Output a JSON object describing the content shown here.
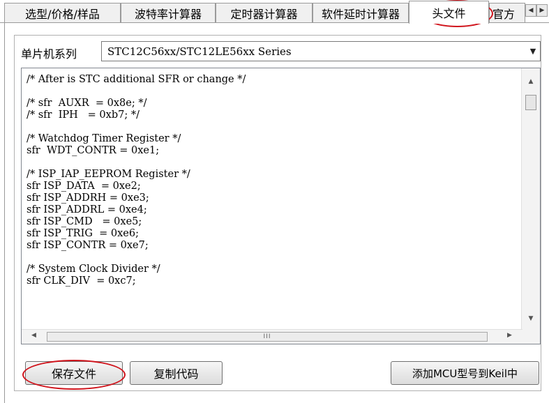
{
  "tabs": [
    {
      "label": "选型/价格/样品"
    },
    {
      "label": "波特率计算器"
    },
    {
      "label": "定时器计算器"
    },
    {
      "label": "软件延时计算器"
    },
    {
      "label": "头文件"
    },
    {
      "label": "官方"
    }
  ],
  "tab_scroll": {
    "left_glyph": "◀",
    "right_glyph": "▶"
  },
  "series": {
    "label": "单片机系列",
    "selected": "STC12C56xx/STC12LE56xx Series"
  },
  "code": {
    "text": "/* After is STC additional SFR or change */\n\n/* sfr  AUXR  = 0x8e; */\n/* sfr  IPH   = 0xb7; */\n\n/* Watchdog Timer Register */\nsfr  WDT_CONTR = 0xe1;\n\n/* ISP_IAP_EEPROM Register */\nsfr ISP_DATA  = 0xe2;\nsfr ISP_ADDRH = 0xe3;\nsfr ISP_ADDRL = 0xe4;\nsfr ISP_CMD   = 0xe5;\nsfr ISP_TRIG  = 0xe6;\nsfr ISP_CONTR = 0xe7;\n\n/* System Clock Divider */\nsfr CLK_DIV  = 0xc7;"
  },
  "scrollbar": {
    "up": "▲",
    "down": "▼",
    "left": "◀",
    "right": "▶",
    "grip": "III"
  },
  "buttons": {
    "save": "保存文件",
    "copy": "复制代码",
    "add_keil": "添加MCU型号到Keil中"
  },
  "colors": {
    "annotation": "#d0141c"
  }
}
